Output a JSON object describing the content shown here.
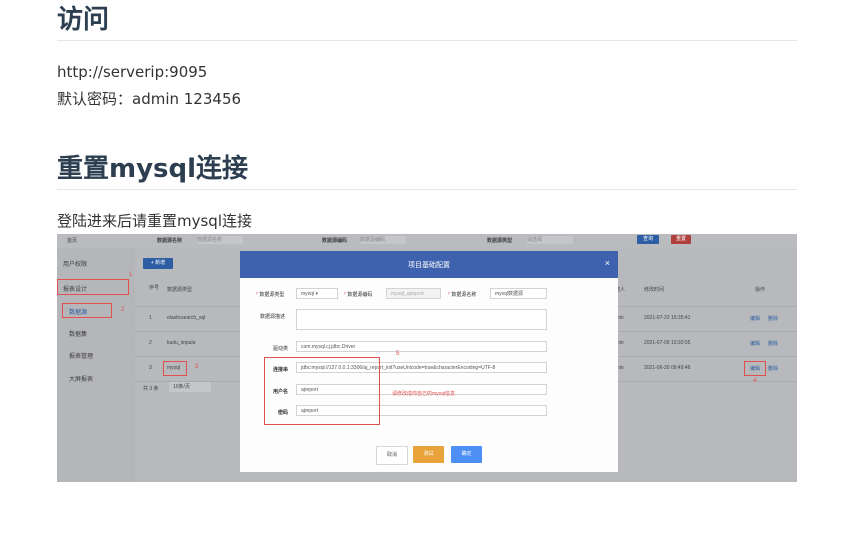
{
  "doc": {
    "heading_access": "访问",
    "url_line": "http://serverip:9095",
    "password_line": "默认密码：admin 123456",
    "heading_reset": "重置mysql连接",
    "instruction": "登陆进来后请重置mysql连接"
  },
  "screenshot": {
    "sidebar": {
      "home": "首页",
      "user_perm": "用户权限",
      "report_design": "报表设计",
      "datasource": "数据源",
      "dataset": "数据集",
      "report_mgmt": "报表管理",
      "bigscreen": "大屏报表"
    },
    "toolbar": {
      "ds_name_label": "数据源名称",
      "ds_name_placeholder": "数据源名称",
      "ds_code_label": "数据源编码",
      "ds_code_placeholder": "数据源编码",
      "ds_type_label": "数据源类型",
      "ds_type_placeholder": "请选择",
      "query_btn": "查询",
      "reset_btn": "重置",
      "add_btn": "+ 新增"
    },
    "table": {
      "col_seq": "序号",
      "col_type": "数据源类型",
      "col_creator": "创建人",
      "col_modified": "修改时间",
      "col_ops": "操作",
      "rows": [
        {
          "seq": "1",
          "type": "elasticsearch_sql",
          "creator": "admin",
          "modified": "2021-07-23 15:35:41",
          "edit": "编辑",
          "delete": "删除"
        },
        {
          "seq": "2",
          "type": "kudu_impala",
          "creator": "admin",
          "modified": "2021-07-09 10:30:55",
          "edit": "编辑",
          "delete": "删除"
        },
        {
          "seq": "3",
          "type": "mysql",
          "creator": "admin",
          "modified": "2021-06-30 09:49:46",
          "edit": "编辑",
          "delete": "删除"
        }
      ],
      "total": "共 3 条",
      "page_size": "10条/页"
    },
    "annotations": {
      "n1": "1",
      "n2": "2",
      "n3": "3",
      "n4": "4",
      "n5": "5",
      "note": "请修改成你自己的mysql信息"
    },
    "modal": {
      "title": "项目基础配置",
      "close": "×",
      "type_label": "数据源类型",
      "type_value": "mysql",
      "code_label": "数据源编码",
      "code_value": "mysql_ajreport",
      "name_label": "数据源名称",
      "name_value": "mysql数据源",
      "desc_label": "数据源描述",
      "driver_label": "驱动类",
      "driver_value": "com.mysql.cj.jdbc.Driver",
      "url_label": "连接串",
      "url_value": "jdbc:mysql://127.0.0.1:3306/aj_report_init?useUnicode=true&characterEncoding=UTF-8",
      "user_label": "用户名",
      "user_value": "ajreport",
      "pwd_label": "密码",
      "pwd_value": "ajreport",
      "cancel_btn": "取消",
      "test_btn": "测试",
      "ok_btn": "确定"
    },
    "colors": {
      "modal_header": "#3e62ad",
      "annotation_red": "#e0504e",
      "test_btn": "#e8a33a",
      "ok_btn": "#4d8ff5"
    }
  }
}
